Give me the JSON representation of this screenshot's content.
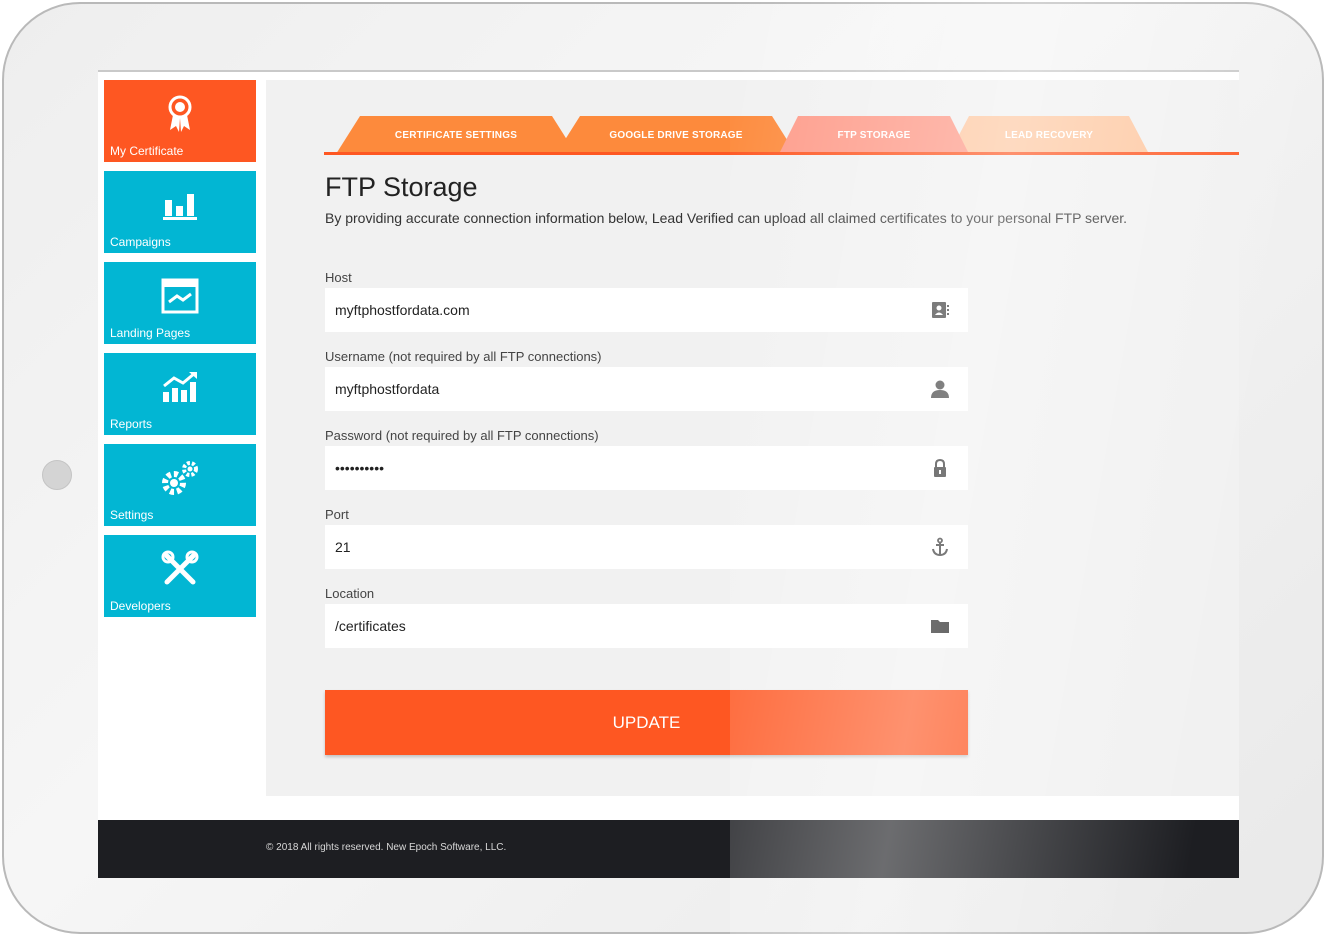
{
  "sidebar": {
    "items": [
      {
        "label": "My Certificate",
        "icon": "award-ribbon-icon",
        "active": true
      },
      {
        "label": "Campaigns",
        "icon": "bar-chart-icon"
      },
      {
        "label": "Landing Pages",
        "icon": "browser-window-icon"
      },
      {
        "label": "Reports",
        "icon": "trending-chart-icon"
      },
      {
        "label": "Settings",
        "icon": "gears-icon"
      },
      {
        "label": "Developers",
        "icon": "tools-icon"
      }
    ]
  },
  "tabs": [
    {
      "label": "CERTIFICATE SETTINGS"
    },
    {
      "label": "GOOGLE DRIVE STORAGE"
    },
    {
      "label": "FTP STORAGE",
      "active": true
    },
    {
      "label": "LEAD RECOVERY"
    }
  ],
  "main": {
    "title": "FTP Storage",
    "description": "By providing accurate connection information below, Lead Verified can upload all claimed certificates to your personal FTP server."
  },
  "form": {
    "host": {
      "label": "Host",
      "value": "myftphostfordata.com",
      "icon": "address-book-icon"
    },
    "username": {
      "label": "Username (not required by all FTP connections)",
      "value": "myftphostfordata",
      "icon": "user-icon"
    },
    "password": {
      "label": "Password (not required by all FTP connections)",
      "value": "••••••••••",
      "icon": "lock-icon"
    },
    "port": {
      "label": "Port",
      "value": "21",
      "icon": "anchor-icon"
    },
    "location": {
      "label": "Location",
      "value": "/certificates",
      "icon": "folder-icon"
    },
    "submit_label": "UPDATE"
  },
  "footer": {
    "text": "© 2018 All rights reserved. New Epoch Software, LLC."
  },
  "colors": {
    "accent": "#fe5722",
    "nav_tile": "#02b6d3",
    "footer": "#1d1e22"
  }
}
